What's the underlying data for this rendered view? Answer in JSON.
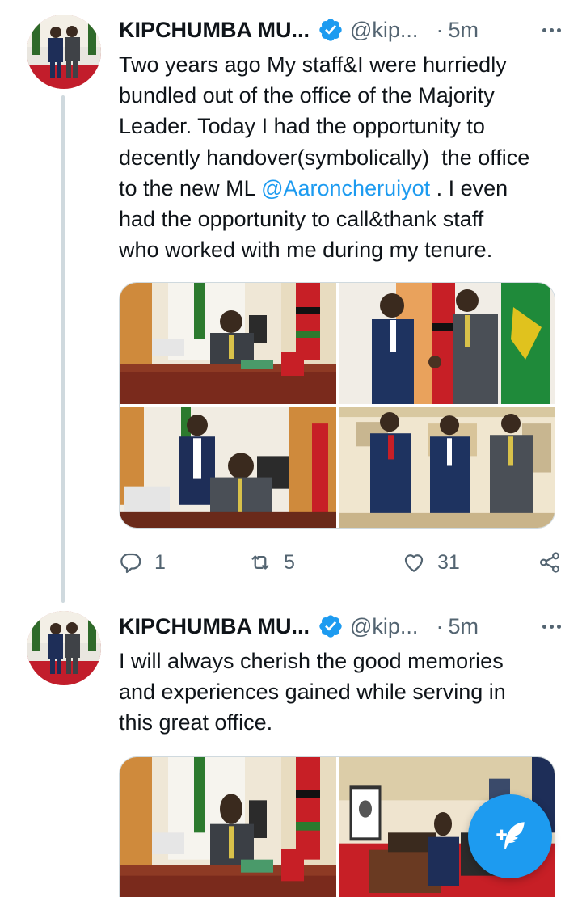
{
  "tweets": [
    {
      "author_name": "KIPCHUMBA MU...",
      "handle": "@kip...",
      "separator": "·",
      "time": "5m",
      "text_before_mention": "Two years ago My staff&I were hurriedly\nbundled out of the office of the Majority\nLeader. Today I had the opportunity to\ndecently handover(symbolically)  the office\nto the new ML ",
      "mention": "@Aaroncheruiyot",
      "text_after_mention": " . I even\nhad the opportunity to call&thank staff\nwho worked with me during my tenure.",
      "photos": [
        "photo-man-at-office-desk",
        "photo-handshake-with-flags",
        "photo-man-on-phone-at-desk",
        "photo-three-men-standing"
      ],
      "reply_count": "1",
      "retweet_count": "5",
      "like_count": "31"
    },
    {
      "author_name": "KIPCHUMBA MU...",
      "handle": "@kip...",
      "separator": "·",
      "time": "5m",
      "text": "I will always cherish the good memories\nand experiences gained while serving in\nthis great office.",
      "photos": [
        "photo-man-at-office-desk",
        "photo-office-meeting-room"
      ]
    }
  ],
  "icons": {
    "verified": "verified-badge-icon",
    "reply": "reply-icon",
    "retweet": "retweet-icon",
    "like": "heart-icon",
    "share": "share-icon",
    "compose": "compose-tweet-icon"
  },
  "colors": {
    "accent": "#1d9bf0",
    "text": "#0f1419",
    "secondary": "#536471",
    "border": "#cfd9de"
  }
}
